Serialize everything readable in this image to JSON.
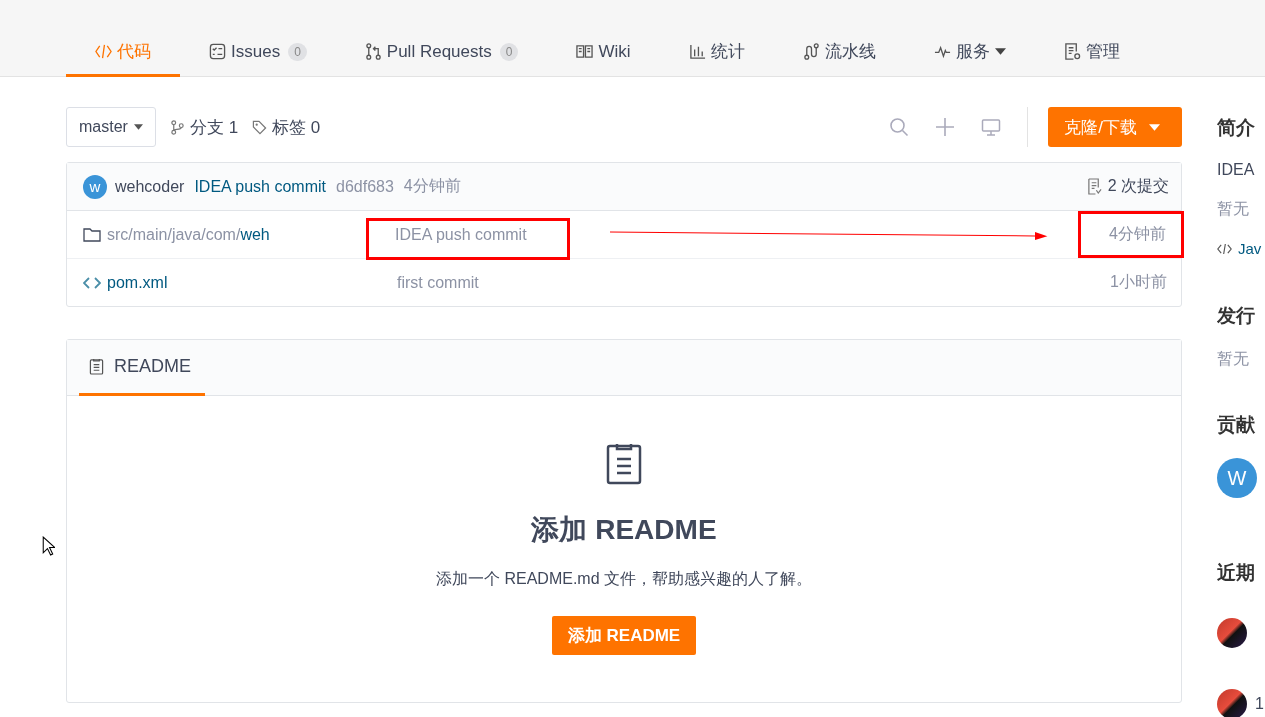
{
  "tabs": [
    {
      "label": "代码",
      "selected": true
    },
    {
      "label": "Issues",
      "count": "0",
      "selected": false
    },
    {
      "label": "Pull Requests",
      "count": "0",
      "selected": false
    },
    {
      "label": "Wiki",
      "selected": false
    },
    {
      "label": "统计",
      "selected": false
    },
    {
      "label": "流水线",
      "selected": false
    },
    {
      "label": "服务",
      "dropdown": true,
      "selected": false
    },
    {
      "label": "管理",
      "selected": false
    }
  ],
  "toolbar": {
    "branch": "master",
    "branches": "分支 1",
    "tags": "标签 0",
    "clone_button": "克隆/下载"
  },
  "latest_commit": {
    "avatar": "w",
    "author": "wehcoder",
    "message": "IDEA push commit",
    "hash": "d6df683",
    "time": "4分钟前",
    "commits": "2 次提交"
  },
  "files": [
    {
      "kind": "folder",
      "parent": "src/main/java/com/",
      "name": "weh",
      "message": "IDEA push commit",
      "time": "4分钟前",
      "highlighted": true
    },
    {
      "kind": "file",
      "name": "pom.xml",
      "message": "first commit",
      "time": "1小时前",
      "highlighted": false
    }
  ],
  "readme": {
    "tab": "README",
    "title": "添加 README",
    "description": "添加一个 README.md 文件，帮助感兴趣的人了解。",
    "button": "添加 README"
  },
  "sidebar": {
    "intro_heading": "简介",
    "intro_text": "IDEA",
    "tags_text": "暂无",
    "language": "Jav",
    "releases_heading": "发行",
    "releases_text": "暂无",
    "contributors_heading": "贡献",
    "contributors": [
      "W"
    ],
    "activity_heading": "近期",
    "activity": [
      {
        "kind": "avatar_only"
      },
      {
        "kind": "with_text",
        "text": "1"
      }
    ]
  }
}
